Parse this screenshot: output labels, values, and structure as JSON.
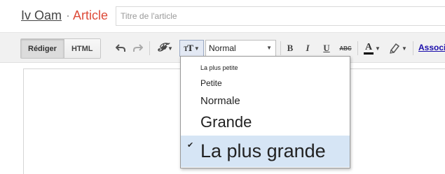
{
  "header": {
    "blog_name": "Iv Oam",
    "separator": "·",
    "breadcrumb": "Article",
    "title_placeholder": "Titre de l'article"
  },
  "toolbar": {
    "mode_compose": "Rédiger",
    "mode_html": "HTML",
    "format_value": "Normal",
    "link_label": "Associ"
  },
  "font_size_menu": {
    "items": [
      {
        "label": "La plus petite",
        "selected": false
      },
      {
        "label": "Petite",
        "selected": false
      },
      {
        "label": "Normale",
        "selected": false
      },
      {
        "label": "Grande",
        "selected": false
      },
      {
        "label": "La plus grande",
        "selected": true
      }
    ],
    "check_mark": "✔"
  },
  "colors": {
    "accent": "#dd4b39",
    "selected_bg": "#d6e5f5",
    "toolbar_bg": "#f1f1f1"
  }
}
